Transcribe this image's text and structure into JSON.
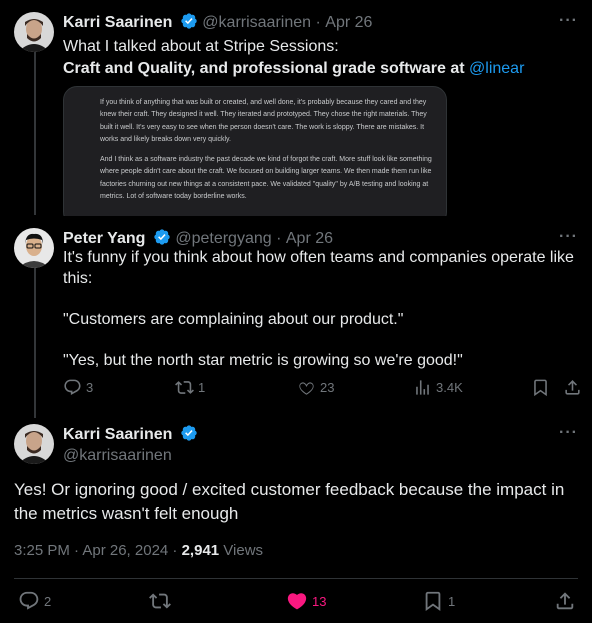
{
  "tweet1": {
    "name": "Karri Saarinen",
    "handle": "@karrisaarinen",
    "sep": "·",
    "date": "Apr 26",
    "text_line1": "What I talked about at Stripe Sessions:",
    "text_bold": "Craft and Quality, and professional grade software at",
    "mention": "@linear",
    "quote_p1": "If you think of anything that was built or created, and well done, it's probably because they cared and they knew their craft. They designed it well. They iterated and prototyped. They chose the right materials. They built it well. It's very easy to see when the person doesn't care. The work is sloppy. There are mistakes. It works and likely breaks down very quickly.",
    "quote_p2": "And I think as a software industry the past decade we kind of forgot the craft. More stuff look like something where people didn't care about the craft. We focused on building larger teams. We then made them run like factories churning out new things at a consistent pace. We validated \"quality\" by A/B testing and looking at metrics. Lot of software today borderline works."
  },
  "tweet2": {
    "name": "Peter Yang",
    "handle": "@petergyang",
    "sep": "·",
    "date": "Apr 26",
    "p1": "It's funny if you think about how often teams and companies operate like this:",
    "p2": "\"Customers are complaining about our product.\"",
    "p3": "\"Yes, but the north star metric is growing so we're good!\"",
    "replies": "3",
    "retweets": "1",
    "likes": "23",
    "views": "3.4K"
  },
  "tweet3": {
    "name": "Karri Saarinen",
    "handle": "@karrisaarinen",
    "text": "Yes! Or ignoring good / excited customer feedback because the impact in the metrics wasn't felt enough",
    "time": "3:25 PM · Apr 26, 2024 · ",
    "views_count": "2,941",
    "views_label": " Views",
    "replies": "2",
    "likes": "13",
    "bookmarks": "1"
  },
  "colors": {
    "background": "#000000",
    "text": "#e7e9ea",
    "muted": "#71767b",
    "link": "#1d9bf0",
    "like": "#f91880",
    "verified": "#1d9bf0"
  }
}
